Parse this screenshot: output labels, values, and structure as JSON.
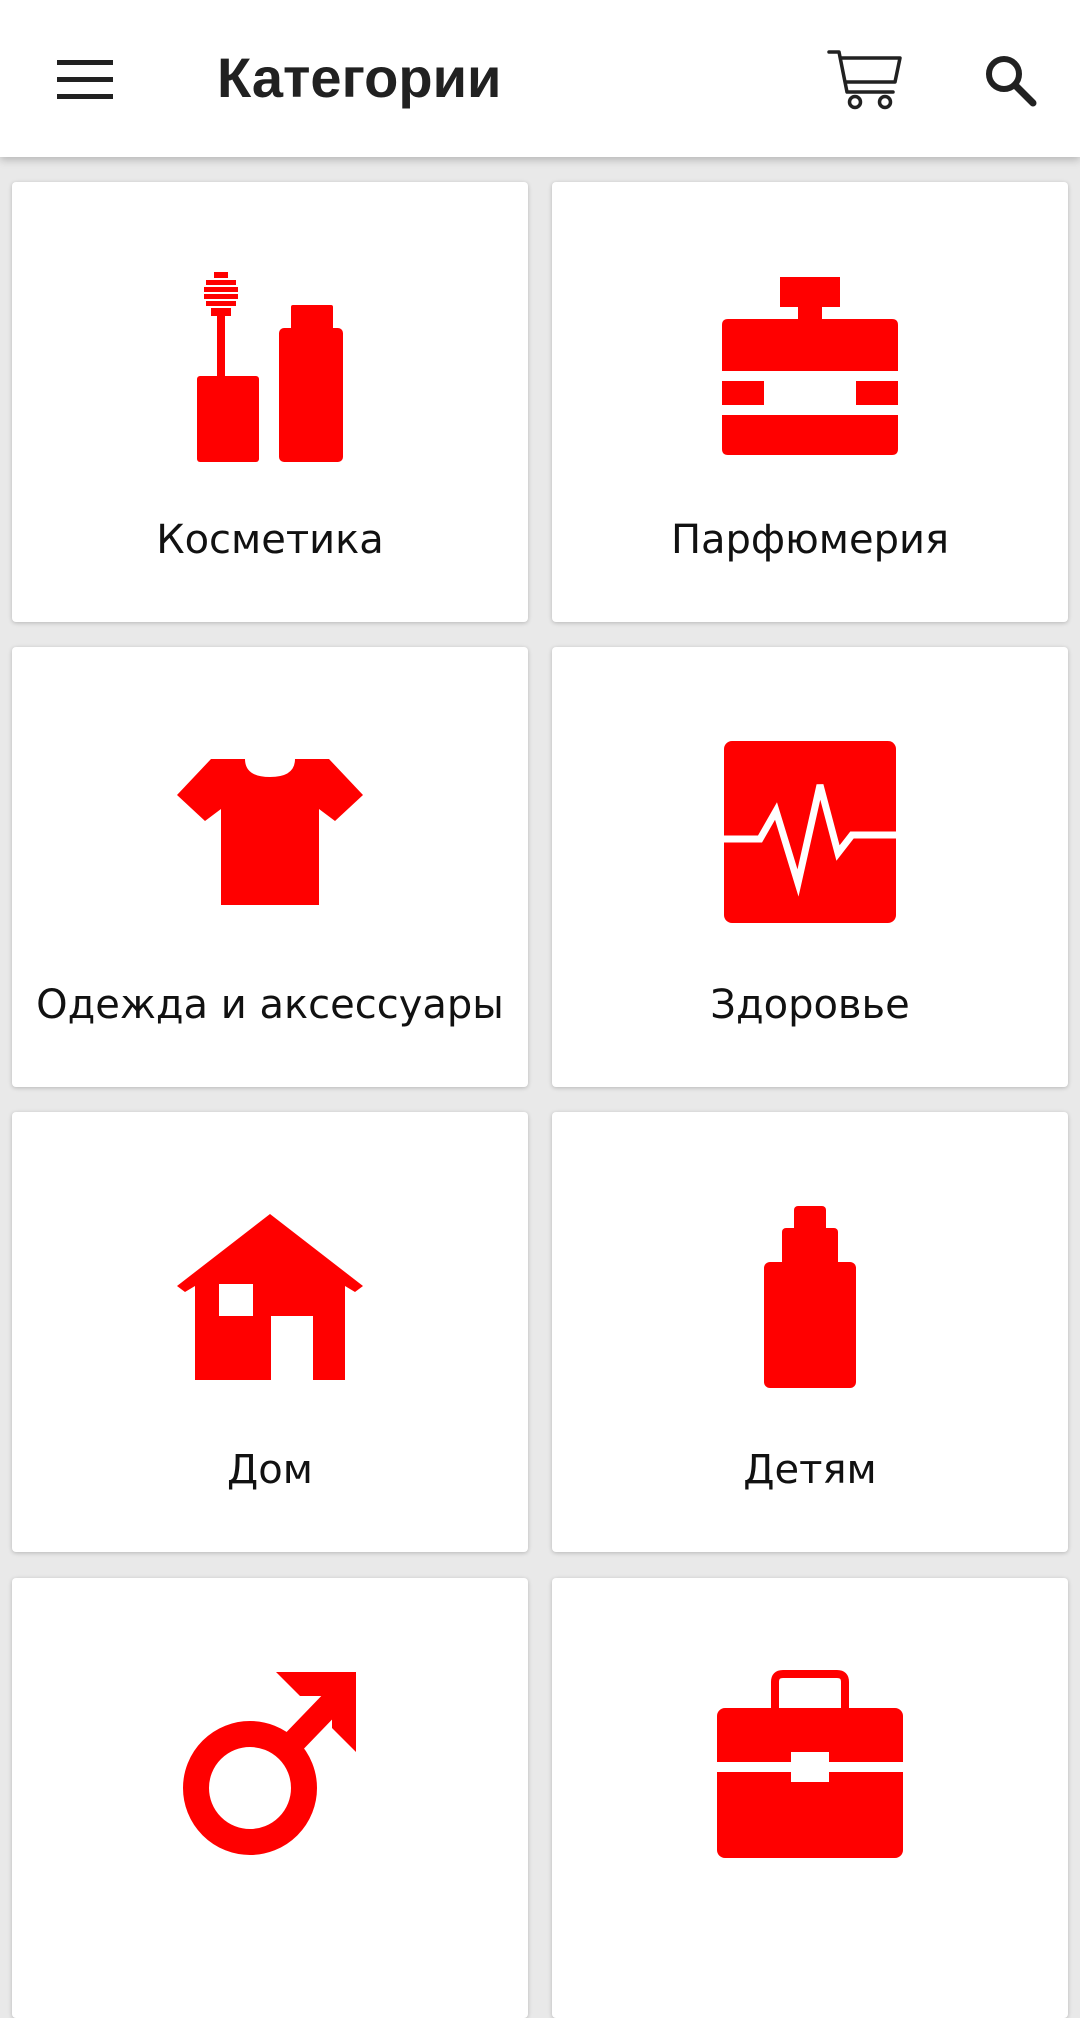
{
  "header": {
    "title": "Категории",
    "menu_icon": "hamburger-menu-icon",
    "cart_icon": "shopping-cart-icon",
    "search_icon": "search-icon"
  },
  "theme": {
    "accent": "#ff0000",
    "text": "#111111",
    "background": "#e9e9e9"
  },
  "categories": [
    {
      "label": "Косметика",
      "icon": "cosmetics-icon"
    },
    {
      "label": "Парфюмерия",
      "icon": "perfume-bottle-icon"
    },
    {
      "label": "Одежда и аксессуары",
      "icon": "t-shirt-icon"
    },
    {
      "label": "Здоровье",
      "icon": "heartbeat-icon"
    },
    {
      "label": "Дом",
      "icon": "house-icon"
    },
    {
      "label": "Детям",
      "icon": "baby-bottle-icon"
    },
    {
      "label": "",
      "icon": "male-symbol-icon"
    },
    {
      "label": "",
      "icon": "briefcase-icon"
    }
  ]
}
